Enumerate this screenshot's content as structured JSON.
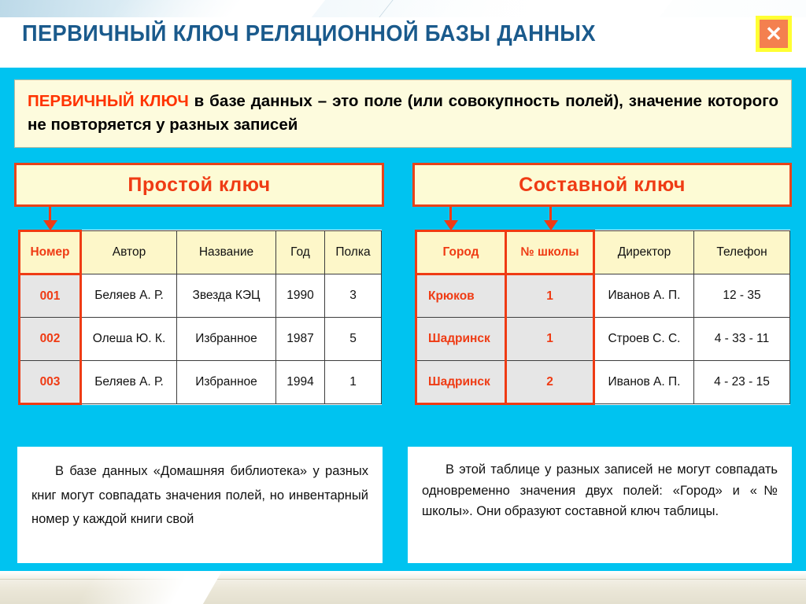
{
  "header": {
    "title": "ПЕРВИЧНЫЙ КЛЮЧ РЕЛЯЦИОННОЙ БАЗЫ ДАННЫХ",
    "close_label": "✕",
    "close_icon": "close-icon"
  },
  "definition": {
    "keyword": "ПЕРВИЧНЫЙ   КЛЮЧ",
    "rest": " в  базе  данных – это  поле (или  совокупность полей),   значение которого не повторяется у разных записей"
  },
  "simple": {
    "heading": "Простой ключ",
    "note": "В  базе  данных  «Домашняя  библиотека»  у  разных  книг  могут  совпадать  значения  полей, но инвентарный номер у каждой книги свой",
    "table": {
      "columns": [
        "Номер",
        "Автор",
        "Название",
        "Год",
        "Полка"
      ],
      "key_columns": [
        "Номер"
      ],
      "rows": [
        [
          "001",
          "Беляев А. Р.",
          "Звезда КЭЦ",
          "1990",
          "3"
        ],
        [
          "002",
          "Олеша Ю. К.",
          "Избранное",
          "1987",
          "5"
        ],
        [
          "003",
          "Беляев А. Р.",
          "Избранное",
          "1994",
          "1"
        ]
      ]
    }
  },
  "composite": {
    "heading": "Составной ключ",
    "note": "В этой таблице у разных записей  не могут совпадать  одновременно  значения  двух полей: «Город» и «№ школы». Они образуют составной ключ таблицы.",
    "table": {
      "columns": [
        "Город",
        "№ школы",
        "Директор",
        "Телефон"
      ],
      "key_columns": [
        "Город",
        "№ школы"
      ],
      "rows": [
        [
          "Крюков",
          "1",
          "Иванов А. П.",
          "12 - 35"
        ],
        [
          "Шадринск",
          "1",
          "Строев С. С.",
          "4 - 33 - 11"
        ],
        [
          "Шадринск",
          "2",
          "Иванов А. П.",
          "4 - 23 - 15"
        ]
      ]
    }
  },
  "colors": {
    "background": "#00c3f0",
    "accent_red": "#ef3b14",
    "title_blue": "#1a5a8c",
    "header_cell": "#fdf7c9",
    "key_cell": "#e6e6e6",
    "definition_bg": "#fdfbdd",
    "close_yellow": "#ffff33",
    "close_orange": "#f4804f"
  }
}
